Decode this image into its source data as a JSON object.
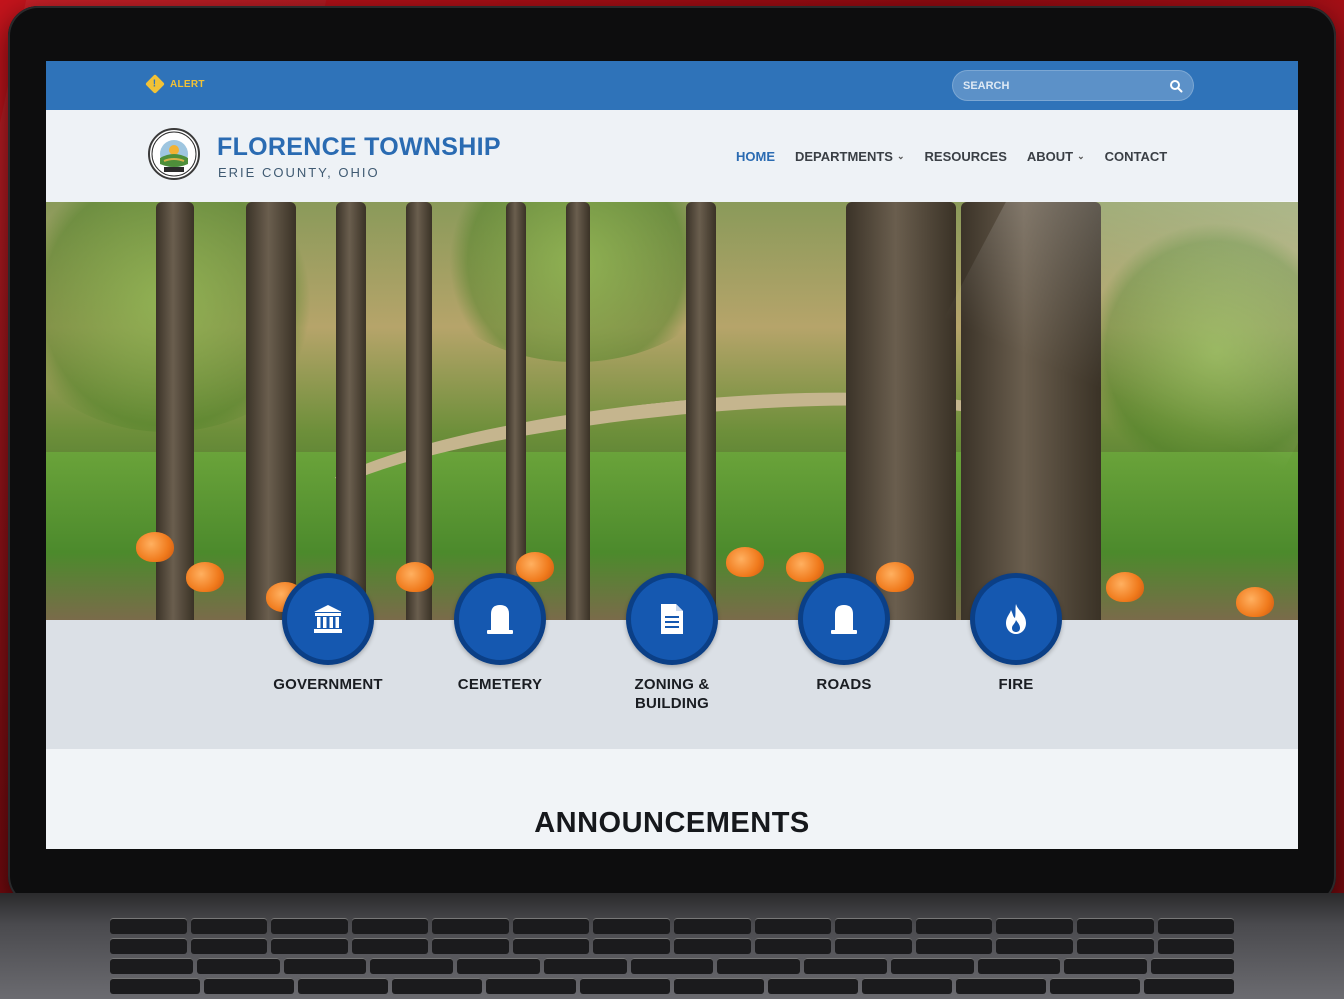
{
  "alert": {
    "label": "ALERT",
    "count": "!"
  },
  "search": {
    "placeholder": "SEARCH"
  },
  "brand": {
    "title": "FLORENCE TOWNSHIP",
    "subtitle": "ERIE COUNTY, OHIO",
    "seal_text": "FLORENCE TWP ERIE CO",
    "seal_est": "EST 1817"
  },
  "nav": {
    "items": [
      {
        "label": "HOME",
        "active": true,
        "dropdown": false
      },
      {
        "label": "DEPARTMENTS",
        "active": false,
        "dropdown": true
      },
      {
        "label": "RESOURCES",
        "active": false,
        "dropdown": false
      },
      {
        "label": "ABOUT",
        "active": false,
        "dropdown": true
      },
      {
        "label": "CONTACT",
        "active": false,
        "dropdown": false
      }
    ]
  },
  "tiles": [
    {
      "label": "GOVERNMENT",
      "icon": "government-building-icon"
    },
    {
      "label": "CEMETERY",
      "icon": "headstone-icon"
    },
    {
      "label": "ZONING & BUILDING",
      "label_line1": "ZONING &",
      "label_line2": "BUILDING",
      "icon": "document-icon"
    },
    {
      "label": "ROADS",
      "icon": "headstone-icon"
    },
    {
      "label": "FIRE",
      "icon": "flame-icon"
    }
  ],
  "announcements": {
    "heading": "ANNOUNCEMENTS"
  },
  "colors": {
    "topbar": "#2f73b9",
    "brand": "#2a6bb2",
    "tile": "#1558b0",
    "alert": "#f2c236"
  }
}
